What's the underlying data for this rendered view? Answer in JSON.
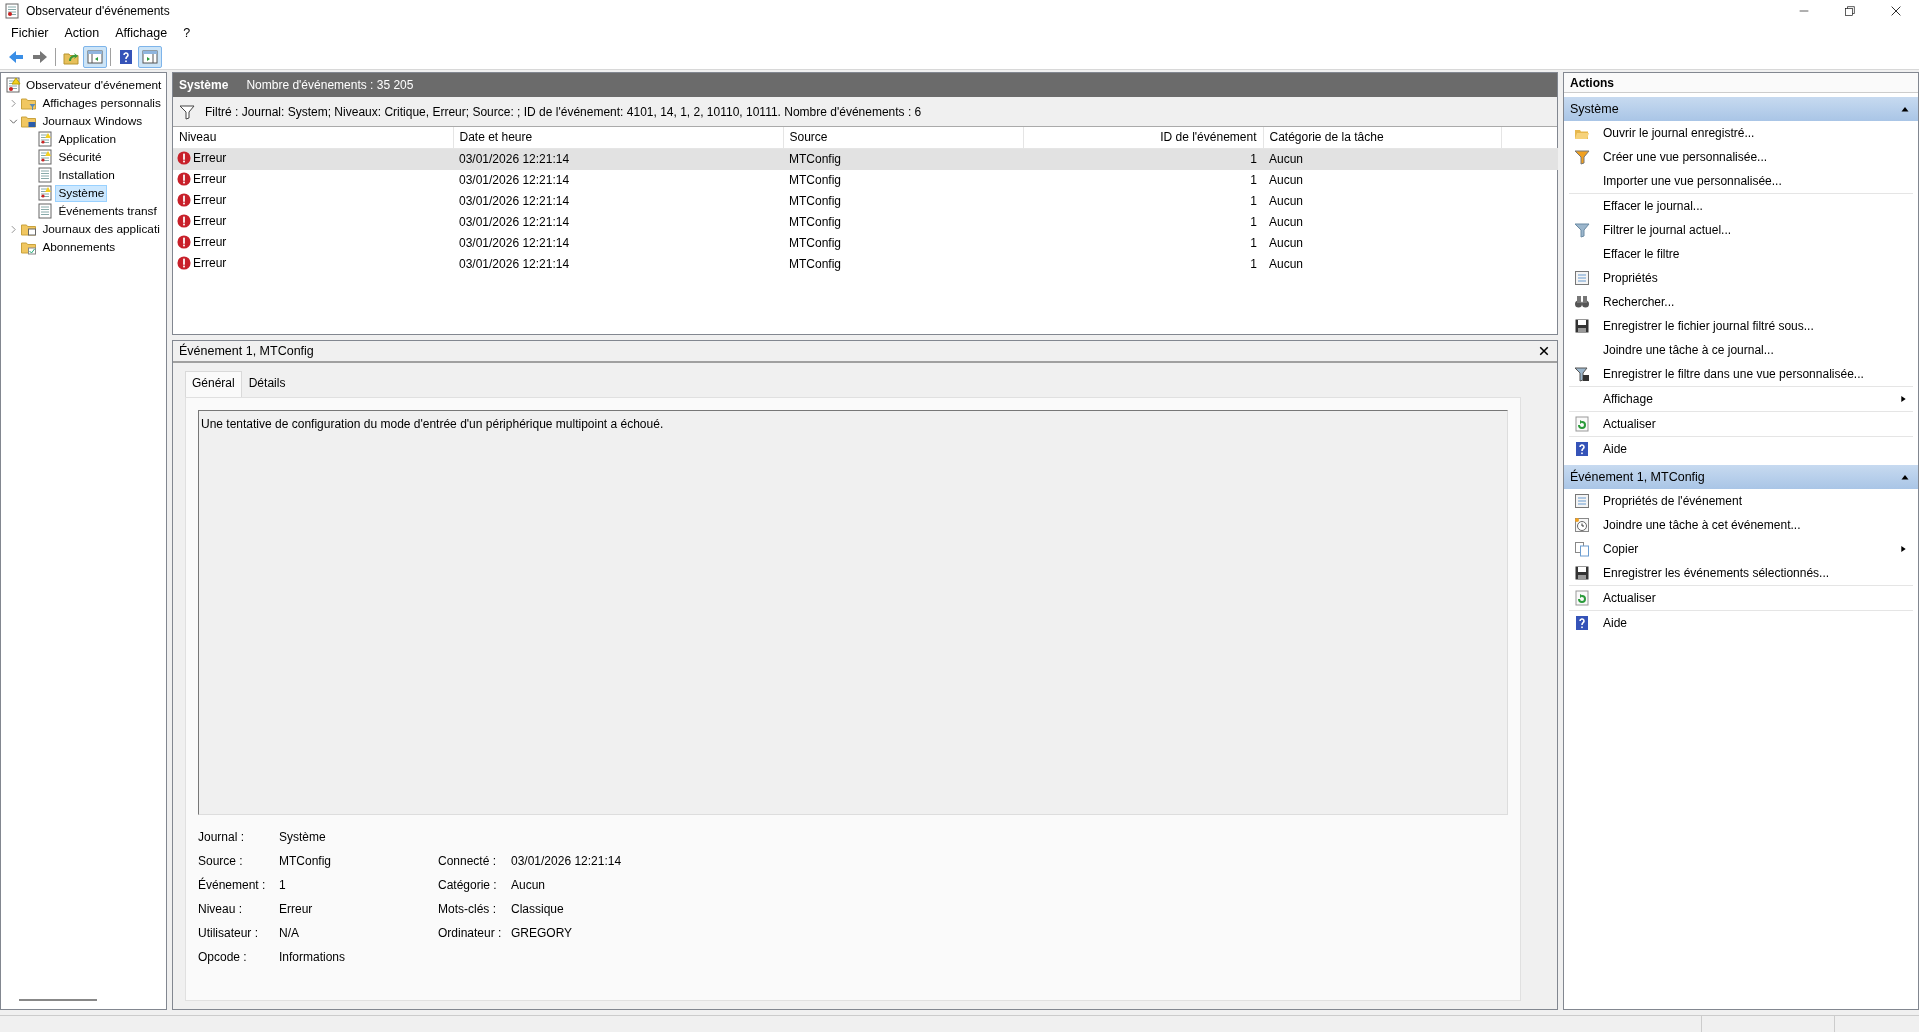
{
  "window": {
    "title": "Observateur d'événements"
  },
  "menu": [
    "Fichier",
    "Action",
    "Affichage",
    "?"
  ],
  "toolbar": [
    {
      "kind": "back",
      "pressed": false
    },
    {
      "kind": "forward",
      "pressed": false
    },
    {
      "kind": "up",
      "pressed": false
    },
    {
      "kind": "leftpane",
      "pressed": true
    },
    {
      "kind": "help",
      "pressed": false
    },
    {
      "kind": "rightpane",
      "pressed": true
    }
  ],
  "tree": [
    {
      "label": "Observateur d'événement",
      "kind": "root",
      "selected": false,
      "children": [
        {
          "label": "Affichages personnalis",
          "kind": "views",
          "selected": false,
          "expanded": false
        },
        {
          "label": "Journaux Windows",
          "kind": "winlogs",
          "selected": false,
          "expanded": true,
          "children": [
            {
              "label": "Application",
              "kind": "alertlog",
              "selected": false
            },
            {
              "label": "Sécurité",
              "kind": "alertlog",
              "selected": false
            },
            {
              "label": "Installation",
              "kind": "log",
              "selected": false
            },
            {
              "label": "Système",
              "kind": "alertlog",
              "selected": true
            },
            {
              "label": "Événements transf",
              "kind": "log",
              "selected": false
            }
          ]
        },
        {
          "label": "Journaux des applicati",
          "kind": "applogs",
          "selected": false,
          "expanded": false
        },
        {
          "label": "Abonnements",
          "kind": "subs",
          "selected": false
        }
      ]
    }
  ],
  "log_header": {
    "title": "Système",
    "count": "Nombre d'événements : 35 205"
  },
  "filter": "Filtré : Journal: System; Niveaux: Critique, Erreur; Source: ; ID de l'événement: 4101, 14, 1, 2, 10110, 10111. Nombre d'événements : 6",
  "table": {
    "columns": [
      "Niveau",
      "Date et heure",
      "Source",
      "ID de l'événement",
      "Catégorie de la tâche"
    ],
    "rows": [
      {
        "level": "Erreur",
        "date": "03/01/2026 12:21:14",
        "source": "MTConfig",
        "id": "1",
        "category": "Aucun",
        "selected": true
      },
      {
        "level": "Erreur",
        "date": "03/01/2026 12:21:14",
        "source": "MTConfig",
        "id": "1",
        "category": "Aucun",
        "selected": false
      },
      {
        "level": "Erreur",
        "date": "03/01/2026 12:21:14",
        "source": "MTConfig",
        "id": "1",
        "category": "Aucun",
        "selected": false
      },
      {
        "level": "Erreur",
        "date": "03/01/2026 12:21:14",
        "source": "MTConfig",
        "id": "1",
        "category": "Aucun",
        "selected": false
      },
      {
        "level": "Erreur",
        "date": "03/01/2026 12:21:14",
        "source": "MTConfig",
        "id": "1",
        "category": "Aucun",
        "selected": false
      },
      {
        "level": "Erreur",
        "date": "03/01/2026 12:21:14",
        "source": "MTConfig",
        "id": "1",
        "category": "Aucun",
        "selected": false
      }
    ]
  },
  "details": {
    "title": "Événement 1, MTConfig",
    "tabs": [
      {
        "label": "Général",
        "selected": true
      },
      {
        "label": "Détails",
        "selected": false
      }
    ],
    "description": "Une tentative de configuration du mode d'entrée d'un périphérique multipoint a échoué.",
    "fields_left": [
      {
        "label": "Journal :",
        "value": "Système"
      },
      {
        "label": "Source :",
        "value": "MTConfig"
      },
      {
        "label": "Événement :",
        "value": "1"
      },
      {
        "label": "Niveau :",
        "value": "Erreur"
      },
      {
        "label": "Utilisateur :",
        "value": "N/A"
      },
      {
        "label": "Opcode :",
        "value": "Informations"
      }
    ],
    "fields_right": [
      {
        "label": "Connecté :",
        "value": "03/01/2026 12:21:14"
      },
      {
        "label": "Catégorie :",
        "value": "Aucun"
      },
      {
        "label": "Mots-clés :",
        "value": "Classique"
      },
      {
        "label": "Ordinateur :",
        "value": "GREGORY"
      }
    ]
  },
  "actions": {
    "title": "Actions",
    "sections": [
      {
        "title": "Système",
        "expanded": true,
        "groups": [
          [
            {
              "label": "Ouvrir le journal enregistré...",
              "kind": "open",
              "submenu": false
            },
            {
              "label": "Créer une vue personnalisée...",
              "kind": "newfilter",
              "submenu": false
            },
            {
              "label": "Importer une vue personnalisée...",
              "kind": "none",
              "submenu": false
            }
          ],
          [
            {
              "label": "Effacer le journal...",
              "kind": "none",
              "submenu": false
            },
            {
              "label": "Filtrer le journal actuel...",
              "kind": "filter",
              "submenu": false
            },
            {
              "label": "Effacer le filtre",
              "kind": "none",
              "submenu": false
            },
            {
              "label": "Propriétés",
              "kind": "properties",
              "submenu": false
            },
            {
              "label": "Rechercher...",
              "kind": "find",
              "submenu": false
            },
            {
              "label": "Enregistrer le fichier journal filtré sous...",
              "kind": "save",
              "submenu": false
            },
            {
              "label": "Joindre une tâche à ce journal...",
              "kind": "none",
              "submenu": false
            },
            {
              "label": "Enregistrer le filtre dans une vue personnalisée...",
              "kind": "savefilter",
              "submenu": false
            }
          ],
          [
            {
              "label": "Affichage",
              "kind": "none",
              "submenu": true
            }
          ],
          [
            {
              "label": "Actualiser",
              "kind": "refresh",
              "submenu": false
            }
          ],
          [
            {
              "label": "Aide",
              "kind": "help",
              "submenu": false
            }
          ]
        ]
      },
      {
        "title": "Événement 1, MTConfig",
        "expanded": true,
        "groups": [
          [
            {
              "label": "Propriétés de l'événement",
              "kind": "properties",
              "submenu": false
            },
            {
              "label": "Joindre une tâche à cet événement...",
              "kind": "task",
              "submenu": false
            },
            {
              "label": "Copier",
              "kind": "copy",
              "submenu": true
            },
            {
              "label": "Enregistrer les événements sélectionnés...",
              "kind": "save",
              "submenu": false
            }
          ],
          [
            {
              "label": "Actualiser",
              "kind": "refresh",
              "submenu": false
            }
          ],
          [
            {
              "label": "Aide",
              "kind": "help",
              "submenu": false
            }
          ]
        ]
      }
    ]
  }
}
